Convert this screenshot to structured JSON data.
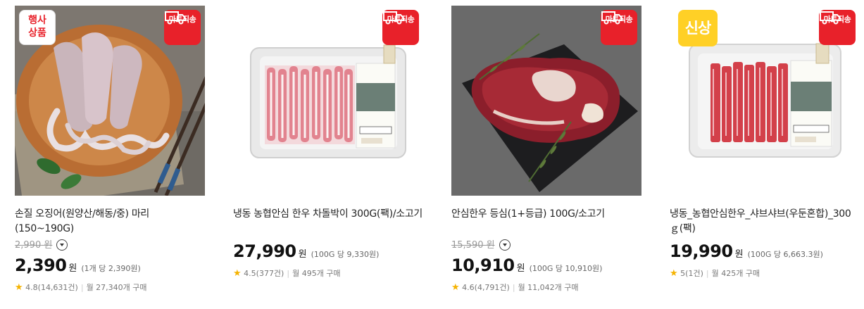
{
  "badges": {
    "mart": "마트직송",
    "event": [
      "행사",
      "상품"
    ],
    "new": "신상"
  },
  "products": [
    {
      "name": "손질 오징어(원양산/해동/중) 마리 (150~190G)",
      "original_price": "2,990",
      "original_won": "원",
      "price": "2,390",
      "won": "원",
      "unit_price": "(1개 당 2,390원)",
      "rating": "4.8(14,631건)",
      "sales": "월 27,340개 구매"
    },
    {
      "name": "냉동 농협안심 한우 차돌박이 300G(팩)/소고기",
      "price": "27,990",
      "won": "원",
      "unit_price": "(100G 당 9,330원)",
      "rating": "4.5(377건)",
      "sales": "월 495개 구매"
    },
    {
      "name": "안심한우 등심(1+등급) 100G/소고기",
      "original_price": "15,590",
      "original_won": "원",
      "price": "10,910",
      "won": "원",
      "unit_price": "(100G 당 10,910원)",
      "rating": "4.6(4,791건)",
      "sales": "월 11,042개 구매"
    },
    {
      "name": "냉동_농협안심한우_샤브샤브(우둔혼합)_300ｇ(팩)",
      "price": "19,990",
      "won": "원",
      "unit_price": "(100G 당 6,663.3원)",
      "rating": "5(1건)",
      "sales": "월 425개 구매"
    }
  ],
  "colors": {
    "accent_red": "#e8212a",
    "new_yellow": "#ffd026",
    "star": "#f5b301"
  }
}
